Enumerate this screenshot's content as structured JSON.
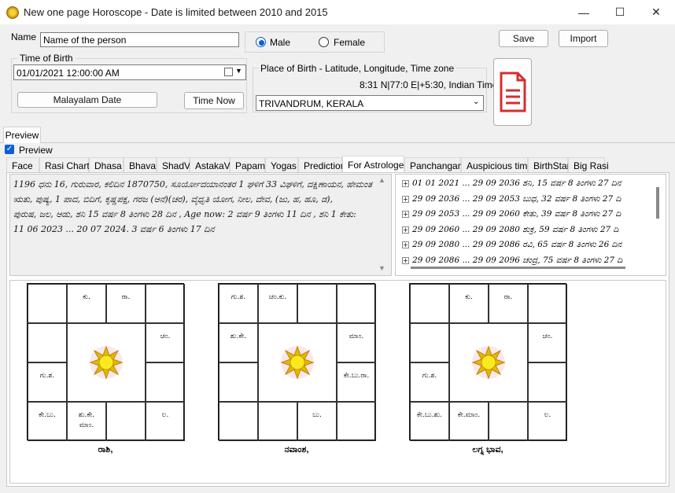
{
  "window": {
    "title": "New one page Horoscope - Date is limited between 2010 and 2015",
    "minimize": "—",
    "maximize": "☐",
    "close": "✕"
  },
  "form": {
    "name_label": "Name",
    "name_value": "Name of the person",
    "gender_male": "Male",
    "gender_female": "Female",
    "gender_selected": "male",
    "save": "Save",
    "import": "Import",
    "time_of_birth_label": "Time of Birth",
    "datetime_value": "01/01/2021  12:00:00 AM",
    "malayalam_date": "Malayalam Date",
    "time_now": "Time Now",
    "place_label": "Place of Birth - Latitude, Longitude, Time zone",
    "coords": "8:31 N|77:0 E|+5:30, Indian Time",
    "place_value": "TRIVANDRUM, KERALA"
  },
  "preview": {
    "section_tab": "Preview",
    "checkbox_label": "Preview",
    "checked": true
  },
  "tabs": [
    {
      "label": "Face"
    },
    {
      "label": "Rasi Charts"
    },
    {
      "label": "Dhasa"
    },
    {
      "label": "Bhava"
    },
    {
      "label": "ShadV"
    },
    {
      "label": "AstakaV"
    },
    {
      "label": "Papam"
    },
    {
      "label": "Yogas"
    },
    {
      "label": "Prediction"
    },
    {
      "label": "For Astrologer",
      "active": true
    },
    {
      "label": "Panchangam"
    },
    {
      "label": "Auspicious time"
    },
    {
      "label": "BirthStar"
    },
    {
      "label": "Big Rasi"
    }
  ],
  "astrologer_text": [
    "1196 ಧನು 16, ಗುರುವಾರ, ಕಲಿದಿನ 1870750, ಸೂರ್ಯೋದಯಾನಂತರ 1 ಘಳಿಗೆ 33 ವಿಘಳಿಗೆ, ದಕ್ಷಿಣಾಯನ, ಹೇಮಂತ",
    "ಋತು, ಪುಷ್ಯ, 1    ಪಾದ, ಬಿದಿಗೆ, ಕೃಷ್ಣಪಕ್ಷ, ಗರಜ (ಆನೆ)(ಚರ), ವೈಧೃತಿ ಯೋಗ, ನೀಲ, ದೇವ, (ಜು, ಹ, ಹೂ, ಡ),",
    "ಪುರುಷ, ಜಲ, ಆಡು, ಶನಿ  15 ವರ್ಷ 8 ತಿಂಗಳು 28 ದಿನ , Age now: 2 ವರ್ಷ 9 ತಿಂಗಳು 11 ದಿನ  , ಶನಿ   1 ಕೇತು:",
    "11   06   2023 ... 20   07   2024.  3 ವರ್ಷ 6 ತಿಂಗಳು 17 ದಿನ"
  ],
  "dasha_tree": [
    "01   01   2021 ... 29   09   2036      ಶನಿ,  15 ವರ್ಷ 8 ತಿಂಗಳು 27 ದಿನ",
    "29   09   2036 ... 29   09   2053      ಬುಧ,  32 ವರ್ಷ 8 ತಿಂಗಳು 27 ದಿ",
    "29   09   2053 ... 29   09   2060      ಕೇತು,  39 ವರ್ಷ 8 ತಿಂಗಳು 27 ದಿ",
    "29   09   2060 ... 29   09   2080      ಶುಕ್ರ,  59 ವರ್ಷ 8 ತಿಂಗಳು 27 ದಿ",
    "29   09   2080 ... 29   09   2086      ರವಿ,  65 ವರ್ಷ 8 ತಿಂಗಳು 26 ದಿನ",
    "29   09   2086 ... 29   09   2096      ಚಂದ್ರ,  75 ವರ್ಷ 8 ತಿಂಗಳು 27 ದಿ"
  ],
  "charts": [
    {
      "caption": "ರಾಶಿ,",
      "cells": {
        "0": "",
        "1": "ಕು.",
        "2": "ರಾ.",
        "3": "",
        "4": "",
        "5": "ಚಂ.",
        "6": "ಗು.ಶ.",
        "7": "",
        "8": "ಕೇ.ಬು.",
        "9": "ಶು.ಕೇ.\nಮಾಂ.",
        "10": "",
        "11": "ಲ."
      }
    },
    {
      "caption": "ನವಾಂಶ,",
      "cells": {
        "0": "ಗು.ಶ.",
        "1": "ಚಂ.ಕು.",
        "2": "",
        "3": "",
        "4": "ಶು.ಕೇ.",
        "5": "ಮಾಂ.",
        "6": "",
        "7": "ಕೇ.ಬು.ರಾ.",
        "8": "",
        "9": "",
        "10": "ಬು.",
        "11": ""
      }
    },
    {
      "caption": "ಲಗ್ನ ಭಾವ,",
      "cells": {
        "0": "",
        "1": "ಕು.",
        "2": "ರಾ.",
        "3": "",
        "4": "",
        "5": "ಚಂ.",
        "6": "ಗು.ಶ.",
        "7": "",
        "8": "ಕೇ.ಬು.ಶು.",
        "9": "ಕೇ.ಮಾಂ.",
        "10": "",
        "11": "ಲ."
      }
    }
  ]
}
